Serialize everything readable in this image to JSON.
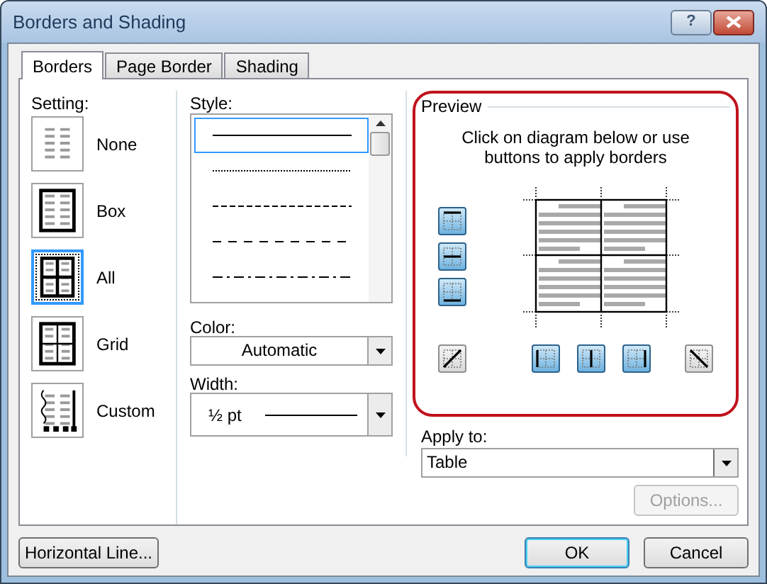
{
  "window": {
    "title": "Borders and Shading",
    "help_button": "?"
  },
  "tabs": [
    {
      "label": "Borders",
      "selected": true
    },
    {
      "label": "Page Border",
      "selected": false
    },
    {
      "label": "Shading",
      "selected": false
    }
  ],
  "setting": {
    "label": "Setting:",
    "options": [
      {
        "label": "None",
        "kind": "none",
        "selected": false
      },
      {
        "label": "Box",
        "kind": "box",
        "selected": false
      },
      {
        "label": "All",
        "kind": "all",
        "selected": true
      },
      {
        "label": "Grid",
        "kind": "grid",
        "selected": false
      },
      {
        "label": "Custom",
        "kind": "custom",
        "selected": false
      }
    ]
  },
  "style": {
    "label": "Style:",
    "items": [
      {
        "kind": "solid",
        "selected": true
      },
      {
        "kind": "dotted",
        "selected": false
      },
      {
        "kind": "dashed",
        "selected": false
      },
      {
        "kind": "long-dash",
        "selected": false
      },
      {
        "kind": "dash-dot",
        "selected": false
      }
    ]
  },
  "color": {
    "label": "Color:",
    "value": "Automatic"
  },
  "width": {
    "label": "Width:",
    "value": "½ pt"
  },
  "preview": {
    "label": "Preview",
    "instruction": "Click on diagram below or use buttons to apply borders",
    "side_buttons": [
      {
        "kind": "top",
        "on": true
      },
      {
        "kind": "middle-h",
        "on": true
      },
      {
        "kind": "bottom",
        "on": true
      }
    ],
    "bottom_buttons": [
      {
        "kind": "diag-up",
        "on": false
      },
      {
        "kind": "left",
        "on": true
      },
      {
        "kind": "middle-v",
        "on": true
      },
      {
        "kind": "right",
        "on": true
      },
      {
        "kind": "diag-down",
        "on": false
      }
    ]
  },
  "apply_to": {
    "label": "Apply to:",
    "value": "Table"
  },
  "options_button": {
    "label": "Options...",
    "disabled": true
  },
  "buttons": [
    {
      "label": "Horizontal Line...",
      "kind": "extra"
    },
    {
      "label": "OK",
      "kind": "default"
    },
    {
      "label": "Cancel",
      "kind": "normal"
    }
  ]
}
